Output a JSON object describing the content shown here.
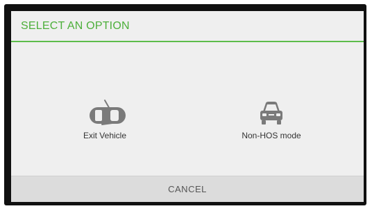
{
  "dialog": {
    "title": "SELECT AN OPTION",
    "options": [
      {
        "label": "Exit Vehicle",
        "icon": "car-door-open-icon"
      },
      {
        "label": "Non-HOS mode",
        "icon": "car-front-icon"
      }
    ],
    "cancel_label": "CANCEL"
  },
  "colors": {
    "accent": "#4caf3a",
    "background": "#efefef",
    "footer": "#dcdcdc",
    "icon": "#7a7a7a"
  }
}
